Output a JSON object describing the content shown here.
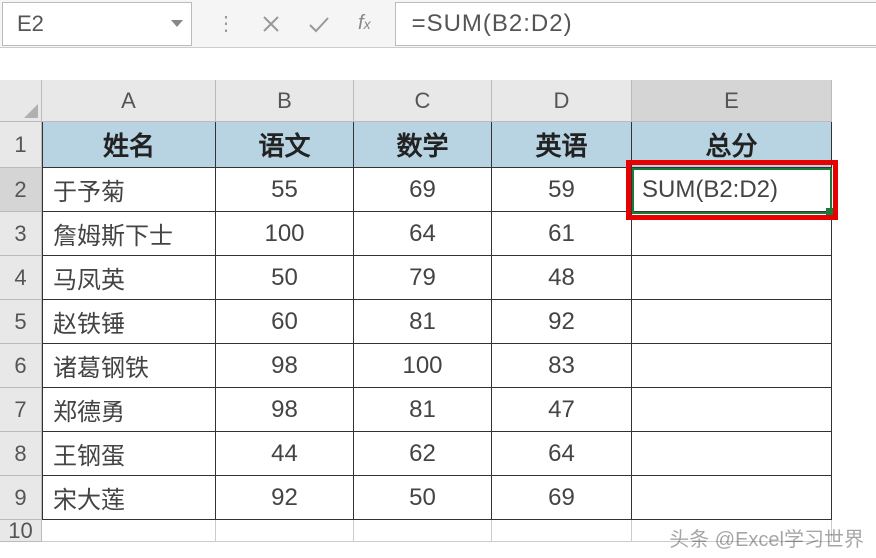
{
  "formula_bar": {
    "name_box": "E2",
    "formula": "=SUM(B2:D2)"
  },
  "columns": [
    "A",
    "B",
    "C",
    "D",
    "E"
  ],
  "row_numbers": [
    "1",
    "2",
    "3",
    "4",
    "5",
    "6",
    "7",
    "8",
    "9",
    "10"
  ],
  "headers": {
    "a": "姓名",
    "b": "语文",
    "c": "数学",
    "d": "英语",
    "e": "总分"
  },
  "rows": [
    {
      "name": "于予菊",
      "b": "55",
      "c": "69",
      "d": "59",
      "e": "SUM(B2:D2)"
    },
    {
      "name": "詹姆斯下士",
      "b": "100",
      "c": "64",
      "d": "61",
      "e": ""
    },
    {
      "name": "马凤英",
      "b": "50",
      "c": "79",
      "d": "48",
      "e": ""
    },
    {
      "name": "赵铁锤",
      "b": "60",
      "c": "81",
      "d": "92",
      "e": ""
    },
    {
      "name": "诸葛钢铁",
      "b": "98",
      "c": "100",
      "d": "83",
      "e": ""
    },
    {
      "name": "郑德勇",
      "b": "98",
      "c": "81",
      "d": "47",
      "e": ""
    },
    {
      "name": "王钢蛋",
      "b": "44",
      "c": "62",
      "d": "64",
      "e": ""
    },
    {
      "name": "宋大莲",
      "b": "92",
      "c": "50",
      "d": "69",
      "e": ""
    }
  ],
  "watermark": "头条 @Excel学习世界",
  "chart_data": {
    "type": "table",
    "title": "",
    "columns": [
      "姓名",
      "语文",
      "数学",
      "英语",
      "总分"
    ],
    "data": [
      [
        "于予菊",
        55,
        69,
        59,
        null
      ],
      [
        "詹姆斯下士",
        100,
        64,
        61,
        null
      ],
      [
        "马凤英",
        50,
        79,
        48,
        null
      ],
      [
        "赵铁锤",
        60,
        81,
        92,
        null
      ],
      [
        "诸葛钢铁",
        98,
        100,
        83,
        null
      ],
      [
        "郑德勇",
        98,
        81,
        47,
        null
      ],
      [
        "王钢蛋",
        44,
        62,
        64,
        null
      ],
      [
        "宋大莲",
        92,
        50,
        69,
        null
      ]
    ],
    "active_cell": "E2",
    "active_formula": "=SUM(B2:D2)"
  }
}
